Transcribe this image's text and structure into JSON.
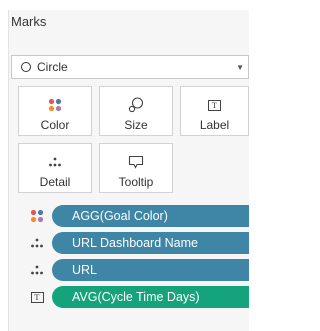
{
  "marks": {
    "title": "Marks",
    "mark_type": {
      "selected": "Circle",
      "icon": "circle-icon"
    },
    "buttons": [
      {
        "label": "Color",
        "icon": "color-dots-icon"
      },
      {
        "label": "Size",
        "icon": "size-icon"
      },
      {
        "label": "Label",
        "icon": "label-text-icon"
      },
      {
        "label": "Detail",
        "icon": "detail-dots-icon"
      },
      {
        "label": "Tooltip",
        "icon": "tooltip-icon"
      }
    ],
    "pills": [
      {
        "label": "AGG(Goal Color)",
        "icon": "color-dots-icon",
        "color": "#3e85a6"
      },
      {
        "label": "URL Dashboard Name",
        "icon": "detail-dots-icon",
        "color": "#3e85a6"
      },
      {
        "label": "URL",
        "icon": "detail-dots-icon",
        "color": "#3e85a6"
      },
      {
        "label": "AVG(Cycle Time Days)",
        "icon": "label-text-icon",
        "color": "#15a37b"
      }
    ]
  }
}
